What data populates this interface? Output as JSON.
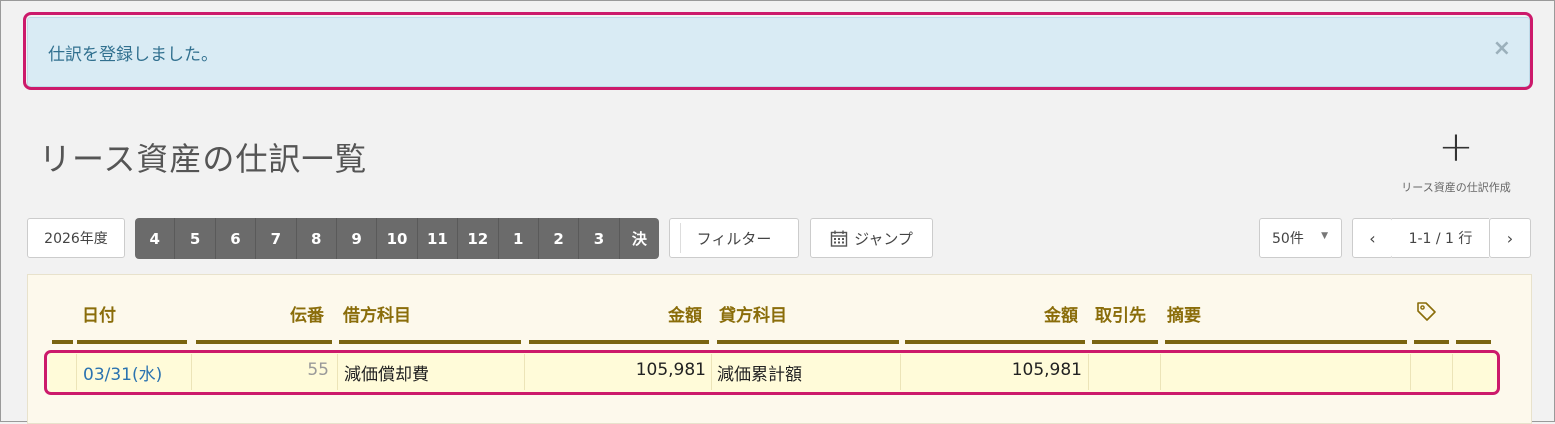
{
  "alert": {
    "message": "仕訳を登録しました。",
    "close": "×"
  },
  "page": {
    "title": "リース資産の仕訳一覧",
    "create_label": "リース資産の仕訳作成",
    "create_icon": "+"
  },
  "toolbar": {
    "fiscal_year": "2026年度",
    "months": [
      "4",
      "5",
      "6",
      "7",
      "8",
      "9",
      "10",
      "11",
      "12",
      "1",
      "2",
      "3",
      "決"
    ],
    "filter_label": "フィルター",
    "jump_label": "ジャンプ",
    "per_page": "50件",
    "prev": "‹",
    "page_info": "1-1 / 1 行",
    "next": "›"
  },
  "table": {
    "headers": {
      "date": "日付",
      "voucher_no": "伝番",
      "debit_account": "借方科目",
      "debit_amount": "金額",
      "credit_account": "貸方科目",
      "credit_amount": "金額",
      "partner": "取引先",
      "memo": "摘要",
      "tag_icon": "tag-icon"
    },
    "rows": [
      {
        "date": "03/31(水)",
        "voucher_no": "55",
        "debit_account": "減価償却費",
        "debit_amount": "105,981",
        "credit_account": "減価累計額",
        "credit_amount": "105,981",
        "partner": "",
        "memo": ""
      }
    ]
  },
  "colors": {
    "highlight": "#cc1a6b",
    "header_text": "#8a6d0a",
    "link": "#2b73b0"
  }
}
